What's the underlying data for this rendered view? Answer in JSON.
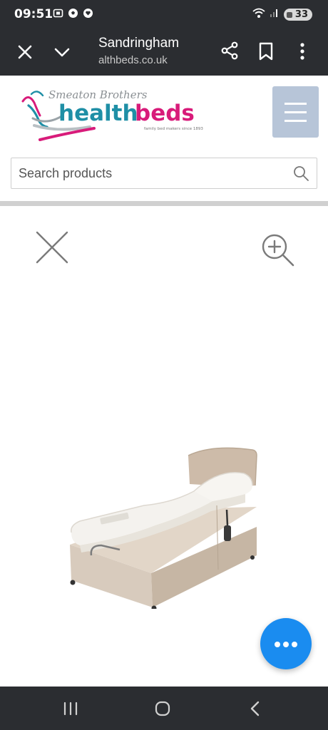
{
  "status_bar": {
    "time": "09:51",
    "battery": "33",
    "left_icons": [
      "screenshot-icon",
      "football-icon",
      "heart-message-icon"
    ],
    "right_icons": [
      "wifi-icon",
      "signal-icon",
      "battery-icon"
    ]
  },
  "browser": {
    "title": "Sandringham",
    "url": "althbeds.co.uk",
    "icons": [
      "close-icon",
      "chevron-down-icon",
      "share-icon",
      "bookmark-icon",
      "more-vert-icon"
    ]
  },
  "site": {
    "logo": {
      "script_text": "Smeaton Brothers",
      "brand_part1": "health",
      "brand_part2": "beds",
      "tagline": "family bed makers since 1893",
      "colors": {
        "teal": "#1f8fa6",
        "magenta": "#d81b7a"
      }
    },
    "menu_icon": "hamburger-menu-icon",
    "menu_button_color": "#b7c5d8",
    "search": {
      "placeholder": "Search products",
      "icon": "search-icon"
    }
  },
  "viewer": {
    "close_icon": "close-icon",
    "zoom_icon": "zoom-in-icon",
    "product_image": "adjustable-bed-image",
    "fab_icon": "more-horizontal-icon",
    "fab_color": "#1a8cf0"
  },
  "nav_bar": {
    "icons": [
      "recent-apps-icon",
      "home-icon",
      "back-icon"
    ]
  }
}
